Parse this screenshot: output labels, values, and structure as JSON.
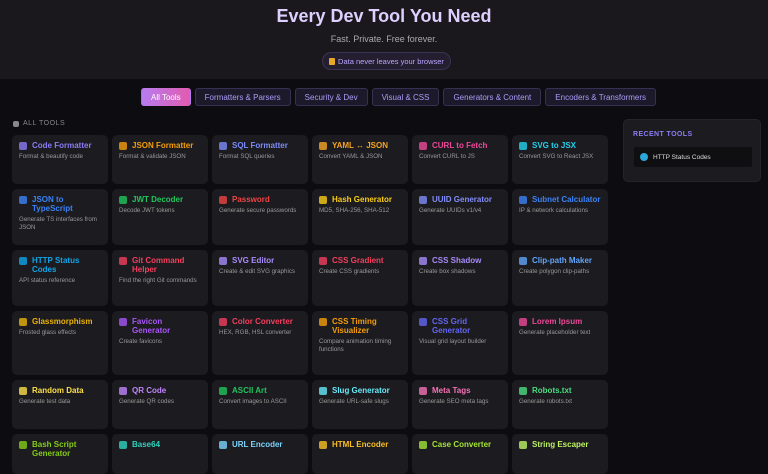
{
  "hero": {
    "title": "Every Dev Tool You Need",
    "subtitle": "Fast. Private. Free forever.",
    "badge": "Data never leaves your browser"
  },
  "tabs": [
    "All Tools",
    "Formatters & Parsers",
    "Security & Dev",
    "Visual & CSS",
    "Generators & Content",
    "Encoders & Transformers"
  ],
  "section_label": "ALL TOOLS",
  "tools": [
    {
      "name": "Code Formatter",
      "desc": "Format & beautify code",
      "color": "#8b7cf6"
    },
    {
      "name": "JSON Formatter",
      "desc": "Format & validate JSON",
      "color": "#f59e0b"
    },
    {
      "name": "SQL Formatter",
      "desc": "Format SQL queries",
      "color": "#7c8cf8"
    },
    {
      "name": "YAML ↔ JSON",
      "desc": "Convert YAML & JSON",
      "color": "#f5a524"
    },
    {
      "name": "CURL to Fetch",
      "desc": "Convert CURL to JS",
      "color": "#ec4899"
    },
    {
      "name": "SVG to JSX",
      "desc": "Convert SVG to React JSX",
      "color": "#22d3ee"
    },
    {
      "name": "JSON to TypeScript",
      "desc": "Generate TS interfaces from JSON",
      "color": "#3b82f6"
    },
    {
      "name": "JWT Decoder",
      "desc": "Decode JWT tokens",
      "color": "#22c55e"
    },
    {
      "name": "Password",
      "desc": "Generate secure passwords",
      "color": "#ef4444"
    },
    {
      "name": "Hash Generator",
      "desc": "MD5, SHA-256, SHA-512",
      "color": "#facc15"
    },
    {
      "name": "UUID Generator",
      "desc": "Generate UUIDs v1/v4",
      "color": "#818cf8"
    },
    {
      "name": "Subnet Calculator",
      "desc": "IP & network calculations",
      "color": "#3b82f6"
    },
    {
      "name": "HTTP Status Codes",
      "desc": "API status reference",
      "color": "#0ea5e9"
    },
    {
      "name": "Git Command Helper",
      "desc": "Find the right Git commands",
      "color": "#f43f5e"
    },
    {
      "name": "SVG Editor",
      "desc": "Create & edit SVG graphics",
      "color": "#a78bfa"
    },
    {
      "name": "CSS Gradient",
      "desc": "Create CSS gradients",
      "color": "#f43f5e"
    },
    {
      "name": "CSS Shadow",
      "desc": "Create box shadows",
      "color": "#a78bfa"
    },
    {
      "name": "Clip-path Maker",
      "desc": "Create polygon clip-paths",
      "color": "#60a5fa"
    },
    {
      "name": "Glassmorphism",
      "desc": "Frosted glass effects",
      "color": "#eab308"
    },
    {
      "name": "Favicon Generator",
      "desc": "Create favicons",
      "color": "#a855f7"
    },
    {
      "name": "Color Converter",
      "desc": "HEX, RGB, HSL converter",
      "color": "#f43f5e"
    },
    {
      "name": "CSS Timing Visualizer",
      "desc": "Compare animation timing functions",
      "color": "#f59e0b"
    },
    {
      "name": "CSS Grid Generator",
      "desc": "Visual grid layout builder",
      "color": "#6366f1"
    },
    {
      "name": "Lorem Ipsum",
      "desc": "Generate placeholder text",
      "color": "#ec4899"
    },
    {
      "name": "Random Data",
      "desc": "Generate test data",
      "color": "#fde047"
    },
    {
      "name": "QR Code",
      "desc": "Generate QR codes",
      "color": "#c084fc"
    },
    {
      "name": "ASCII Art",
      "desc": "Convert images to ASCII",
      "color": "#22c55e"
    },
    {
      "name": "Slug Generator",
      "desc": "Generate URL-safe slugs",
      "color": "#67e8f9"
    },
    {
      "name": "Meta Tags",
      "desc": "Generate SEO meta tags",
      "color": "#f472b6"
    },
    {
      "name": "Robots.txt",
      "desc": "Generate robots.txt",
      "color": "#4ade80"
    },
    {
      "name": "Bash Script Generator",
      "color": "#84cc16"
    },
    {
      "name": "Base64",
      "color": "#2dd4bf"
    },
    {
      "name": "URL Encoder",
      "color": "#7dd3fc"
    },
    {
      "name": "HTML Encoder",
      "color": "#fbbf24"
    },
    {
      "name": "Case Converter",
      "color": "#a3e635"
    },
    {
      "name": "String Escaper",
      "color": "#bef264"
    }
  ],
  "recent": {
    "title": "RECENT TOOLS",
    "items": [
      "HTTP Status Codes"
    ]
  }
}
